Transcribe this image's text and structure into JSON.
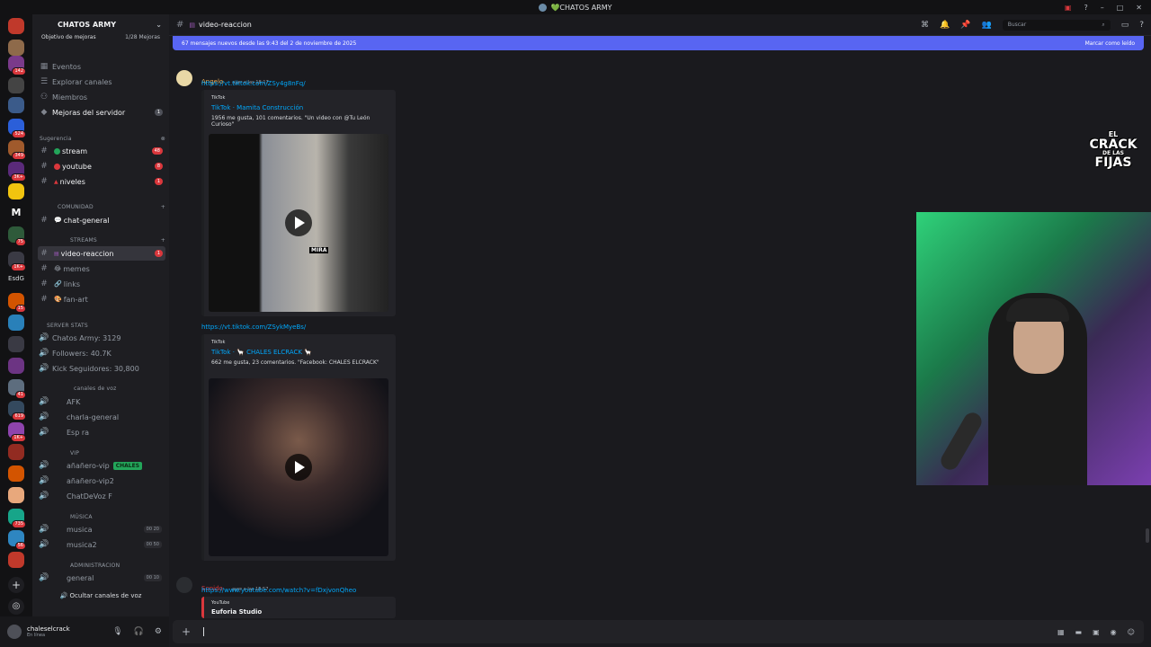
{
  "titlebar": {
    "title": "💚CHATOS ARMY"
  },
  "header": {
    "channel": "video-reaccion",
    "search_placeholder": "Buscar"
  },
  "new_messages": {
    "text": "67 mensajes nuevos desde las 9:43 del 2 de noviembre de 2025",
    "action": "Marcar como leído"
  },
  "server": {
    "name": "CHATOS ARMY",
    "boost_label": "Objetivo de mejoras",
    "boost_progress": "1/28 Mejoras"
  },
  "guild_badges": [
    "142",
    "524",
    "349",
    "3K+",
    "75",
    "1K+",
    "EsdG",
    "15",
    "41",
    "619",
    "1K+",
    "735",
    "56"
  ],
  "sidebar": {
    "events": "Eventos",
    "explore": "Explorar canales",
    "members": "Miembros",
    "boosts": "Mejoras del servidor",
    "boosts_badge": "1",
    "suggestion_cat": "Sugerencia",
    "stream": "stream",
    "stream_badge": "48",
    "youtube": "youtube",
    "youtube_badge": "8",
    "niveles": "niveles",
    "niveles_badge": "1",
    "community_cat": "COMUNIDAD",
    "chat_general": "chat-general",
    "streams_cat": "STREAMS",
    "video_reaccion": "video-reaccion",
    "video_badge": "1",
    "memes": "memes",
    "links": "links",
    "fan_art": "fan-art",
    "stats_cat": "SERVER STATS",
    "stat_members": "Chatos Army: 3129",
    "stat_followers": "Followers: 40.7K",
    "stat_kick": "Kick Seguidores: 30,800",
    "voice_cat": "canales de voz",
    "afk": "AFK",
    "charla": "charla-general",
    "espera": "Esp  ra",
    "vip_cat": "VIP",
    "vip1": "añañero-vip",
    "vip2": "añañero-vip2",
    "chatdevoz": "ChatDeVoz F",
    "speaking_tag": "CHALES",
    "music_cat": "MÚSICA",
    "musica": "musica",
    "musica_count": "00 20",
    "musica2": "musica2",
    "musica2_count": "00 50",
    "admin_cat": "ADMINISTRACION",
    "general": "general",
    "general_count": "00 10",
    "hide_voice": "Ocultar canales de voz"
  },
  "user": {
    "name": "chaleselcrack",
    "status": "En línea"
  },
  "messages": [
    {
      "author": "Angelo",
      "time": "ayer a las 18:17",
      "link": "https://vt.tiktok.com/ZSy4g8nFq/",
      "embed": {
        "provider": "TikTok",
        "title": "TikTok · Mamita Construcción",
        "desc": "1956 me gusta, 101 comentarios. \"Un video con @Tu León Curioso\""
      }
    },
    {
      "link": "https://vt.tiktok.com/ZSykMyeBs/",
      "embed": {
        "provider": "TikTok",
        "title": "TikTok · 🦙 CHALES ELCRACK 🦙",
        "desc": "662 me gusta, 23 comentarios. \"Facebook: CHALES ELCRACK\""
      }
    },
    {
      "author": "Sonido",
      "time": "ayer a las 18:57",
      "link": "https://www.youtube.com/watch?v=fDxjvonQheo",
      "embed": {
        "provider": "YouTube",
        "title": "Euforia Studio"
      }
    }
  ],
  "video_overlay_text": "MIRA",
  "logo": {
    "line1": "EL",
    "line2": "CRACK",
    "line3": "DE LAS",
    "line4": "FIJAS"
  },
  "colors": {
    "accent": "#5865f2",
    "link": "#00a8fc",
    "unread": "#da373c"
  }
}
